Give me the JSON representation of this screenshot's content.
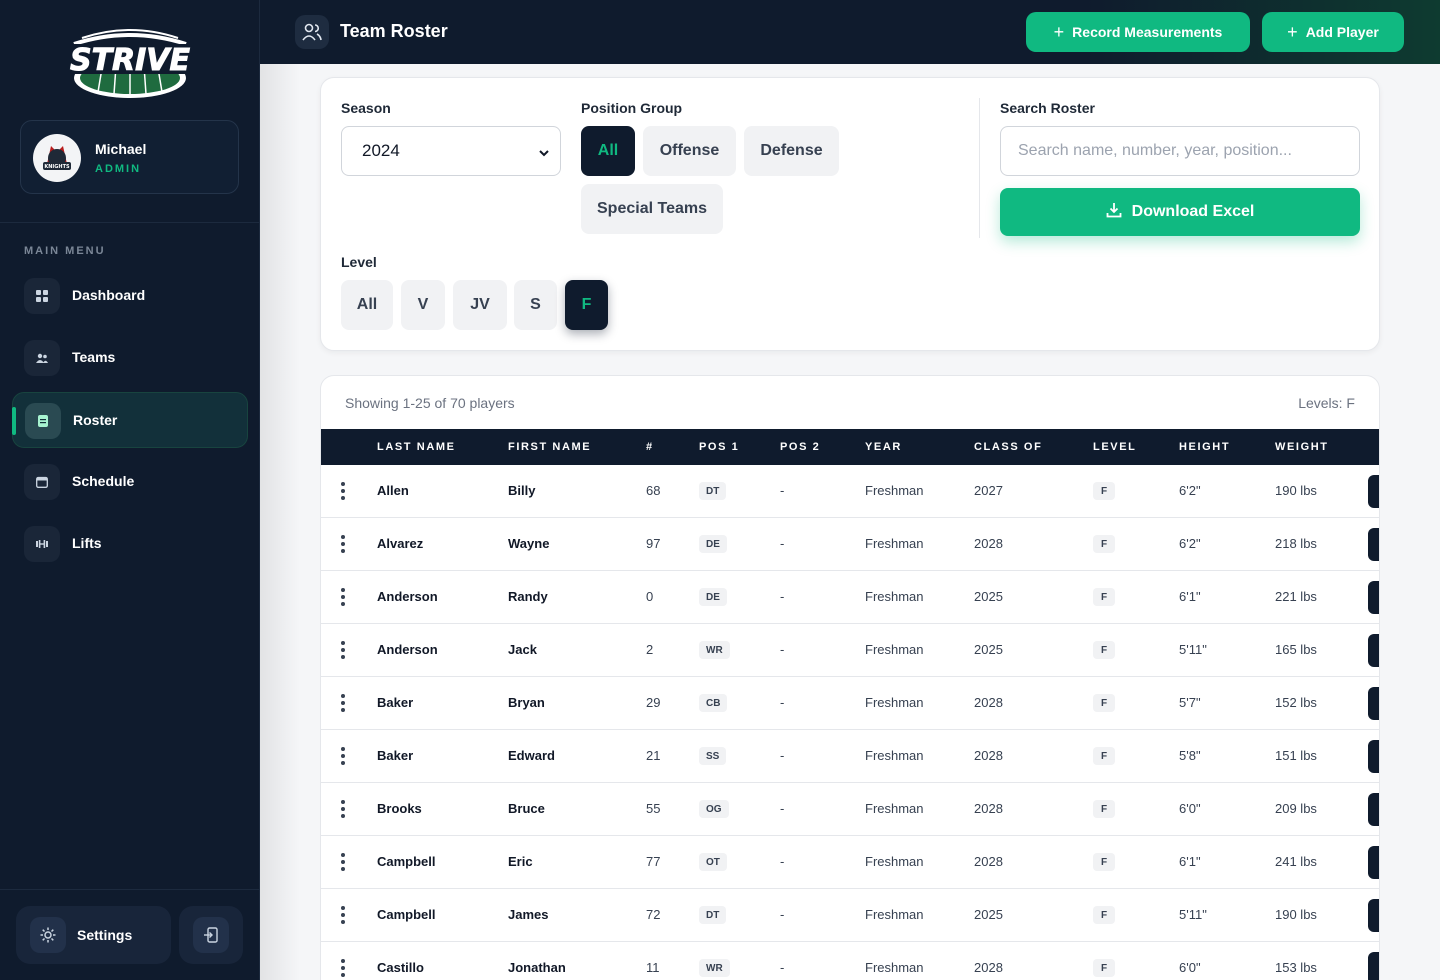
{
  "app": {
    "logo_text": "STRIVE",
    "avatar_text": "KNIGHTS"
  },
  "user": {
    "name": "Michael",
    "role": "ADMIN"
  },
  "sidebar": {
    "menu_title": "MAIN MENU",
    "items": [
      {
        "label": "Dashboard",
        "icon": "grid-icon"
      },
      {
        "label": "Teams",
        "icon": "users-icon"
      },
      {
        "label": "Roster",
        "icon": "clipboard-icon",
        "active": true
      },
      {
        "label": "Schedule",
        "icon": "calendar-icon"
      },
      {
        "label": "Lifts",
        "icon": "dumbbell-icon"
      }
    ],
    "settings_label": "Settings"
  },
  "header": {
    "title": "Team Roster",
    "record_btn": "Record Measurements",
    "add_btn": "Add Player"
  },
  "filters": {
    "season_label": "Season",
    "season_value": "2024",
    "position_label": "Position Group",
    "positions": [
      "All",
      "Offense",
      "Defense",
      "Special Teams"
    ],
    "position_selected": "All",
    "level_label": "Level",
    "levels": [
      "All",
      "V",
      "JV",
      "S",
      "F"
    ],
    "level_selected": "F",
    "search_label": "Search Roster",
    "search_placeholder": "Search name, number, year, position...",
    "download_label": "Download Excel"
  },
  "table": {
    "showing": "Showing 1-25 of 70 players",
    "levels_note": "Levels: F",
    "columns": [
      "LAST NAME",
      "FIRST NAME",
      "#",
      "POS 1",
      "POS 2",
      "YEAR",
      "CLASS OF",
      "LEVEL",
      "HEIGHT",
      "WEIGHT"
    ],
    "rows": [
      {
        "last": "Allen",
        "first": "Billy",
        "num": "68",
        "pos1": "DT",
        "pos2": "-",
        "year": "Freshman",
        "class_of": "2027",
        "level": "F",
        "height": "6'2\"",
        "weight": "190 lbs"
      },
      {
        "last": "Alvarez",
        "first": "Wayne",
        "num": "97",
        "pos1": "DE",
        "pos2": "-",
        "year": "Freshman",
        "class_of": "2028",
        "level": "F",
        "height": "6'2\"",
        "weight": "218 lbs"
      },
      {
        "last": "Anderson",
        "first": "Randy",
        "num": "0",
        "pos1": "DE",
        "pos2": "-",
        "year": "Freshman",
        "class_of": "2025",
        "level": "F",
        "height": "6'1\"",
        "weight": "221 lbs"
      },
      {
        "last": "Anderson",
        "first": "Jack",
        "num": "2",
        "pos1": "WR",
        "pos2": "-",
        "year": "Freshman",
        "class_of": "2025",
        "level": "F",
        "height": "5'11\"",
        "weight": "165 lbs"
      },
      {
        "last": "Baker",
        "first": "Bryan",
        "num": "29",
        "pos1": "CB",
        "pos2": "-",
        "year": "Freshman",
        "class_of": "2028",
        "level": "F",
        "height": "5'7\"",
        "weight": "152 lbs"
      },
      {
        "last": "Baker",
        "first": "Edward",
        "num": "21",
        "pos1": "SS",
        "pos2": "-",
        "year": "Freshman",
        "class_of": "2028",
        "level": "F",
        "height": "5'8\"",
        "weight": "151 lbs"
      },
      {
        "last": "Brooks",
        "first": "Bruce",
        "num": "55",
        "pos1": "OG",
        "pos2": "-",
        "year": "Freshman",
        "class_of": "2028",
        "level": "F",
        "height": "6'0\"",
        "weight": "209 lbs"
      },
      {
        "last": "Campbell",
        "first": "Eric",
        "num": "77",
        "pos1": "OT",
        "pos2": "-",
        "year": "Freshman",
        "class_of": "2028",
        "level": "F",
        "height": "6'1\"",
        "weight": "241 lbs"
      },
      {
        "last": "Campbell",
        "first": "James",
        "num": "72",
        "pos1": "DT",
        "pos2": "-",
        "year": "Freshman",
        "class_of": "2025",
        "level": "F",
        "height": "5'11\"",
        "weight": "190 lbs"
      },
      {
        "last": "Castillo",
        "first": "Jonathan",
        "num": "11",
        "pos1": "WR",
        "pos2": "-",
        "year": "Freshman",
        "class_of": "2028",
        "level": "F",
        "height": "6'0\"",
        "weight": "153 lbs"
      }
    ]
  },
  "colors": {
    "accent": "#10b981",
    "navy": "#0f1b2d"
  }
}
